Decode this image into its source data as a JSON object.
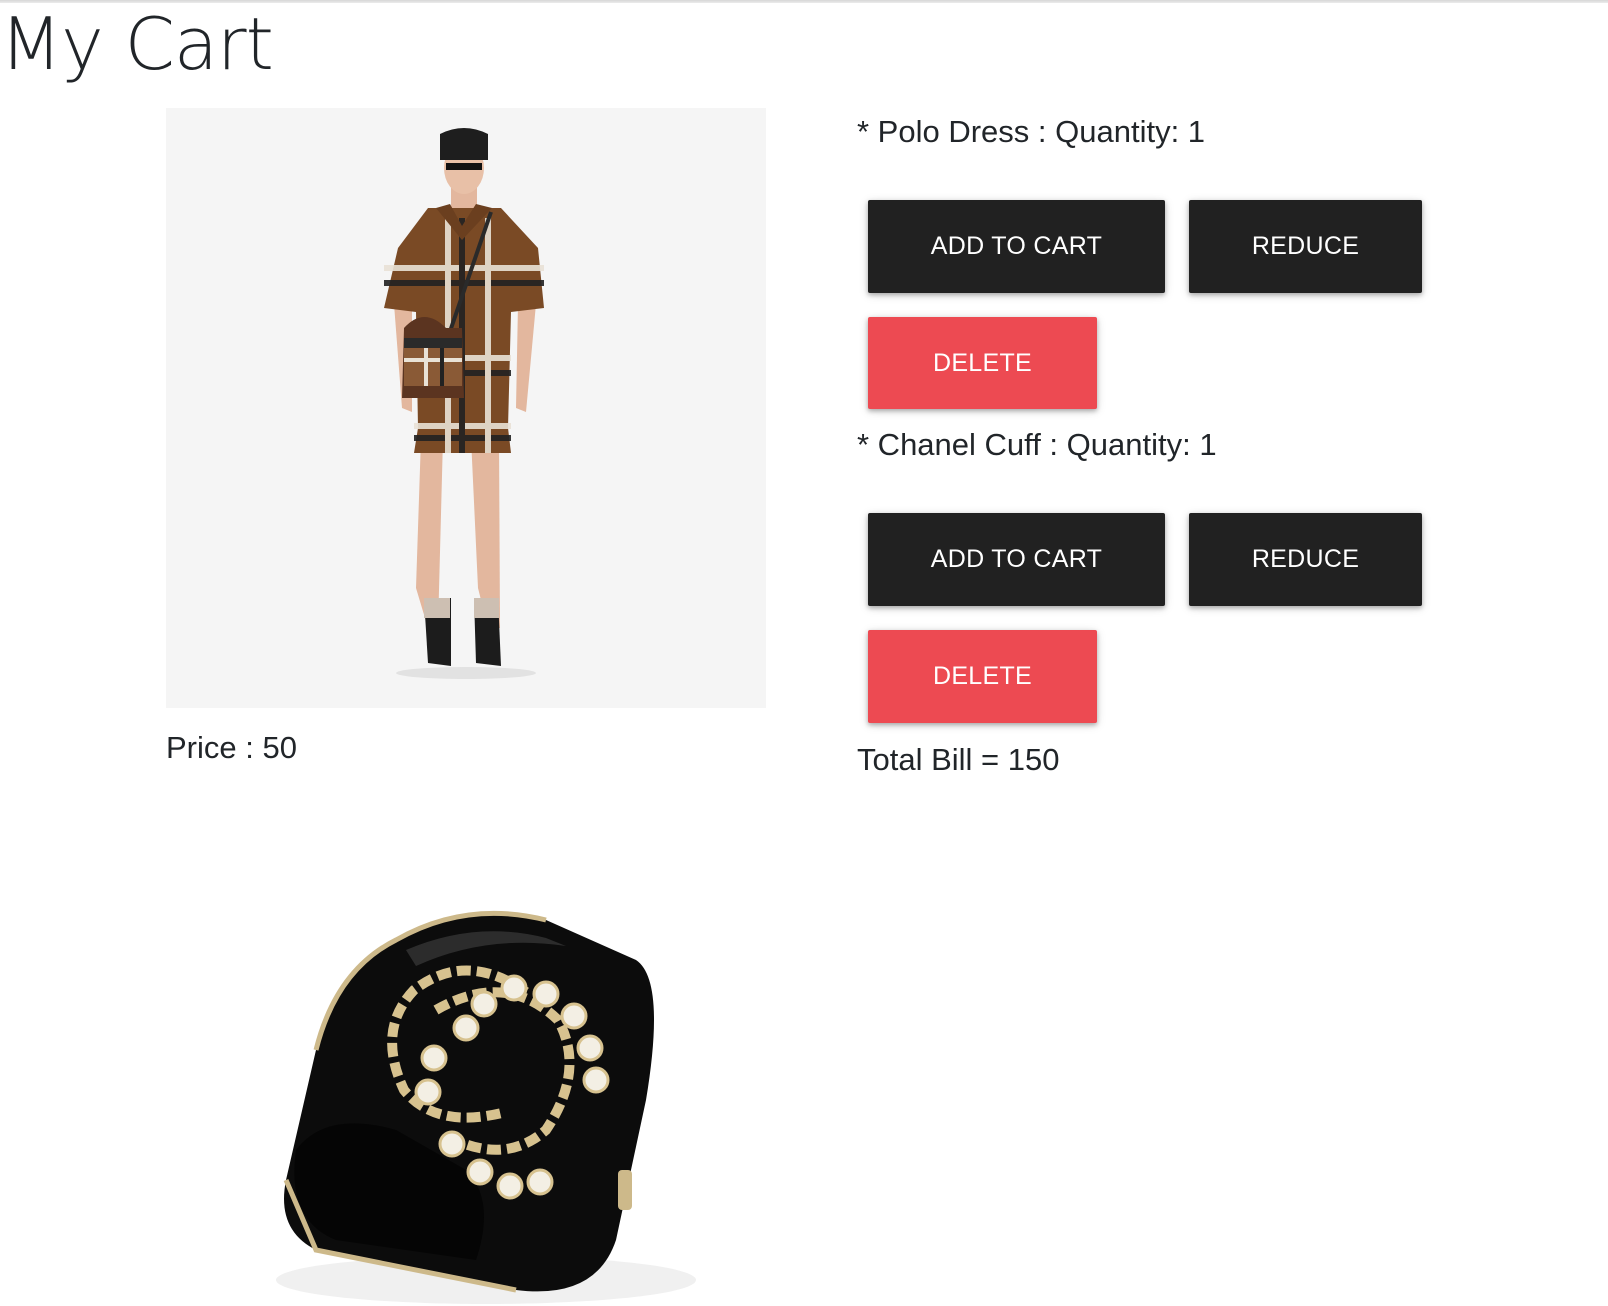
{
  "page": {
    "title": "My Cart"
  },
  "product_preview": {
    "price_text": "Price : 50"
  },
  "cart": {
    "items": [
      {
        "line": "* Polo Dress : Quantity: 1",
        "add_label": "ADD TO CART",
        "reduce_label": "REDUCE",
        "delete_label": "DELETE"
      },
      {
        "line": "* Chanel Cuff : Quantity: 1",
        "add_label": "ADD TO CART",
        "reduce_label": "REDUCE",
        "delete_label": "DELETE"
      }
    ],
    "total_text": "Total Bill = 150"
  },
  "colors": {
    "dark_button": "#212121",
    "danger_button": "#ed4a52",
    "image_background": "#f5f5f5"
  }
}
